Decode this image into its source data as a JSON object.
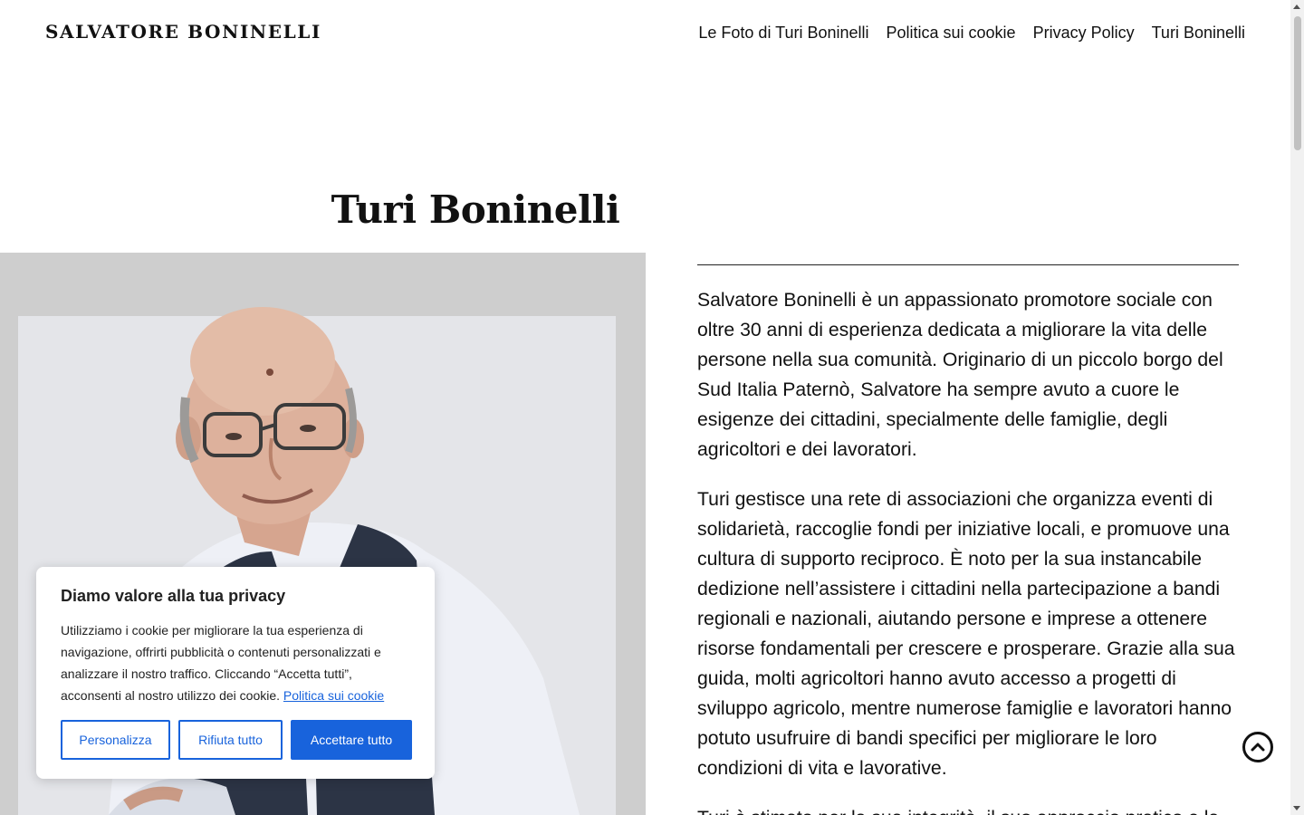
{
  "header": {
    "site_title": "SALVATORE BONINELLI",
    "nav": [
      {
        "label": "Le Foto di Turi Boninelli"
      },
      {
        "label": "Politica sui cookie"
      },
      {
        "label": "Privacy Policy"
      },
      {
        "label": "Turi Boninelli"
      }
    ]
  },
  "main": {
    "title": "Turi Boninelli",
    "paragraphs": [
      "Salvatore Boninelli è un appassionato promotore sociale con oltre 30 anni di esperienza dedicata a migliorare la vita delle persone nella sua comunità. Originario di un piccolo borgo del Sud Italia Paternò, Salvatore ha sempre avuto a cuore le esigenze dei cittadini, specialmente delle famiglie, degli agricoltori e dei lavoratori.",
      "Turi gestisce una rete di associazioni che organizza eventi di solidarietà, raccoglie fondi per iniziative locali, e promuove una cultura di supporto reciproco. È noto per la sua instancabile dedizione nell’assistere i cittadini nella partecipazione a bandi regionali e nazionali, aiutando persone e imprese a ottenere risorse fondamentali per crescere e prosperare. Grazie alla sua guida, molti agricoltori hanno avuto accesso a progetti di sviluppo agricolo, mentre numerose famiglie e lavoratori hanno potuto usufruire di bandi specifici per migliorare le loro condizioni di vita e lavorative.",
      "Turi è stimato per la sua integrità, il suo approccio pratico e la"
    ]
  },
  "cookie_banner": {
    "title": "Diamo valore alla tua privacy",
    "text": "Utilizziamo i cookie per migliorare la tua esperienza di navigazione, offrirti pubblicità o contenuti personalizzati e analizzare il nostro traffico. Cliccando “Accetta tutti”, acconsenti al nostro utilizzo dei cookie.",
    "link": "Politica sui cookie",
    "buttons": {
      "customize": "Personalizza",
      "reject": "Rifiuta tutto",
      "accept": "Accettare tutto"
    }
  },
  "icons": {
    "back_to_top": "chevron-up-circle-icon"
  },
  "colors": {
    "accent": "#1863dc",
    "text": "#111111",
    "photo_background": "#cfcfcf"
  }
}
